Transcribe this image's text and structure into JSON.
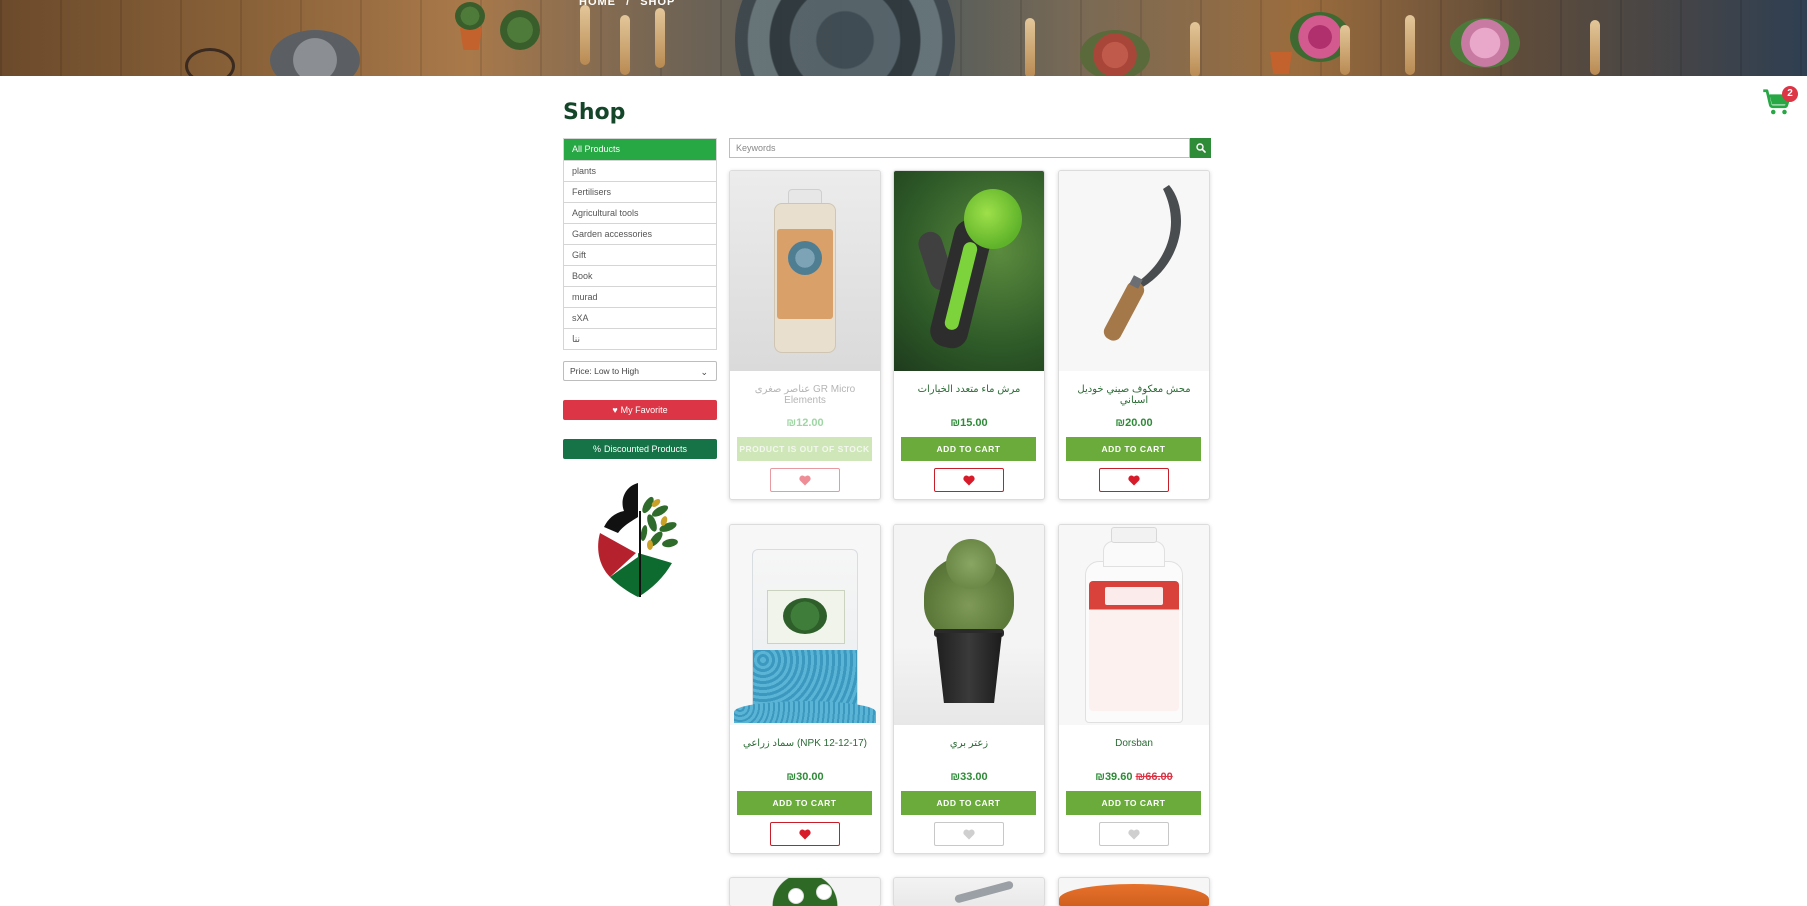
{
  "breadcrumb": {
    "home": "HOME",
    "separator": "/",
    "current": "SHOP"
  },
  "cart": {
    "count": "2",
    "icon": "shopping-cart-icon",
    "color": "#28a745"
  },
  "page": {
    "title": "Shop"
  },
  "sidebar": {
    "categories": [
      {
        "label": "All Products",
        "active": true
      },
      {
        "label": "plants"
      },
      {
        "label": "Fertilisers"
      },
      {
        "label": "Agricultural tools"
      },
      {
        "label": "Garden accessories"
      },
      {
        "label": "Gift"
      },
      {
        "label": "Book"
      },
      {
        "label": "murad"
      },
      {
        "label": "sXA"
      },
      {
        "label": "ننا"
      }
    ],
    "sort": {
      "selected": "Price: Low to High"
    },
    "favorite_label": "My Favorite",
    "discounted_label": "Discounted Products"
  },
  "search": {
    "placeholder": "Keywords",
    "value": ""
  },
  "products": [
    {
      "name": "عناصر صغرى GR Micro Elements",
      "price": "₪12.00",
      "button": "PRODUCT IS OUT OF STOCK",
      "in_stock": false,
      "favorite": true
    },
    {
      "name": "مرش ماء متعدد الخيارات",
      "price": "₪15.00",
      "button": "ADD TO CART",
      "in_stock": true,
      "favorite": true
    },
    {
      "name": "محش معكوف صيني خوديل اسباني",
      "price": "₪20.00",
      "button": "ADD TO CART",
      "in_stock": true,
      "favorite": true
    },
    {
      "name": "سماد زراعي (NPK 12-12-17)",
      "price": "₪30.00",
      "button": "ADD TO CART",
      "in_stock": true,
      "favorite": true
    },
    {
      "name": "زعتر بري",
      "price": "₪33.00",
      "button": "ADD TO CART",
      "in_stock": true,
      "favorite": false
    },
    {
      "name": "Dorsban",
      "price": "₪39.60",
      "old_price": "₪66.00",
      "button": "ADD TO CART",
      "in_stock": true,
      "favorite": false
    }
  ],
  "colors": {
    "accent_green": "#28a745",
    "button_green": "#6aab3c",
    "favorite_red": "#dc3545",
    "title_green": "#14462a"
  }
}
